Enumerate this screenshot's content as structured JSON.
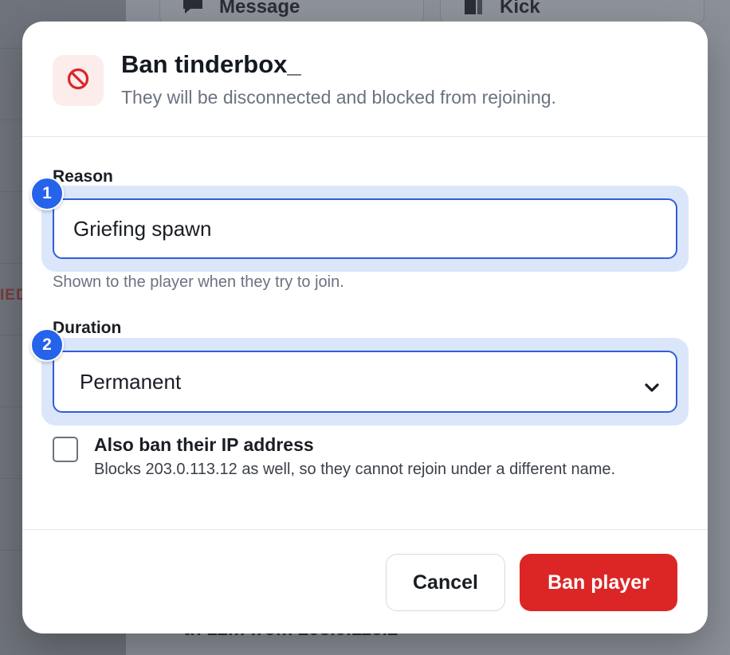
{
  "background": {
    "toolbar_buttons": [
      {
        "label": "Message",
        "icon": "chat-bubble-icon"
      },
      {
        "label": "Kick",
        "icon": "door-exit-icon"
      }
    ],
    "edge_label": "IED",
    "bottom_text": "th 12m from 203.0.113.2"
  },
  "dialog": {
    "icon": "ban-icon",
    "title": "Ban tinderbox_",
    "subtitle": "They will be disconnected and blocked from rejoining.",
    "reason": {
      "label": "Reason",
      "value": "Griefing spawn",
      "help": "Shown to the player when they try to join.",
      "badge": "1"
    },
    "duration": {
      "label": "Duration",
      "selected": "Permanent",
      "badge": "2"
    },
    "ip_ban": {
      "checked": false,
      "title": "Also ban their IP address",
      "description": "Blocks 203.0.113.12 as well, so they cannot rejoin under a different name."
    },
    "buttons": {
      "cancel": "Cancel",
      "confirm": "Ban player"
    }
  },
  "colors": {
    "accent": "#2563eb",
    "danger": "#dc2626",
    "danger_bg": "#fdecec"
  }
}
